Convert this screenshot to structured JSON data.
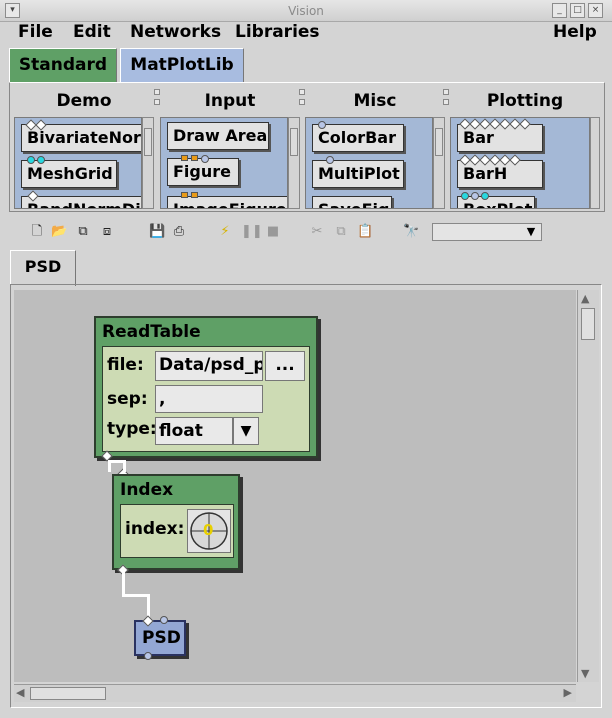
{
  "window": {
    "title": "Vision"
  },
  "menu": {
    "file": "File",
    "edit": "Edit",
    "networks": "Networks",
    "libraries": "Libraries",
    "help": "Help"
  },
  "lib_tabs": {
    "standard": "Standard",
    "matplotlib": "MatPlotLib"
  },
  "categories": {
    "demo": {
      "title": "Demo",
      "items": [
        "BivariateNorm",
        "MeshGrid",
        "RandNormDi"
      ]
    },
    "input": {
      "title": "Input",
      "items": [
        "Draw Area",
        "Figure",
        "ImageFigure"
      ]
    },
    "misc": {
      "title": "Misc",
      "items": [
        "ColorBar",
        "MultiPlot",
        "SaveFig"
      ]
    },
    "plotting": {
      "title": "Plotting",
      "items": [
        "Bar",
        "BarH",
        "BoxPlot"
      ]
    }
  },
  "toolbar": {
    "icons": [
      "new-icon",
      "open-icon",
      "copy-net-icon",
      "paste-net-icon",
      "save-icon",
      "print-icon",
      "run-icon",
      "pause-icon",
      "stop-icon",
      "cut-icon",
      "copy-icon",
      "paste-icon",
      "find-icon"
    ],
    "combo_value": ""
  },
  "network_tab": "PSD",
  "nodes": {
    "readtable": {
      "title": "ReadTable",
      "file_label": "file:",
      "file_value": "Data/psd_p",
      "browse_label": "...",
      "sep_label": "sep:",
      "sep_value": ",",
      "type_label": "type:",
      "type_value": "float"
    },
    "index": {
      "title": "Index",
      "index_label": "index:",
      "dial_value": "0"
    },
    "psd": {
      "title": "PSD"
    }
  },
  "colors": {
    "node_green": "#5fa066",
    "node_panel": "#cddbb4",
    "lib_list_blue": "#a4b8d6",
    "tab_active": "#5fa066",
    "psd_node": "#93a7d4"
  }
}
